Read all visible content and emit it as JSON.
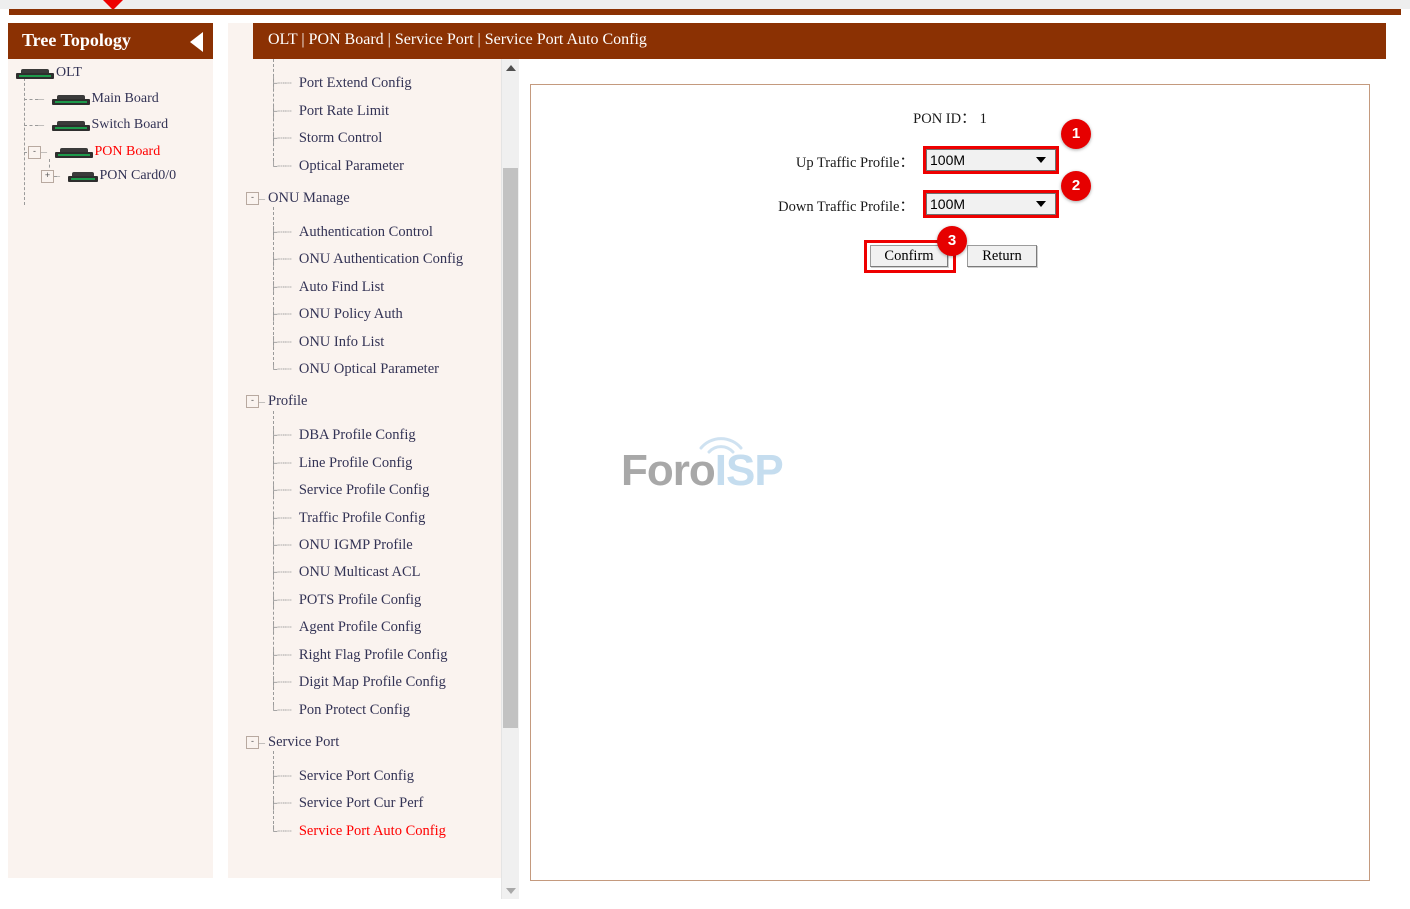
{
  "top": {
    "marker_icon": "red-down-arrow-marker"
  },
  "tree_panel": {
    "title": "Tree Topology",
    "collapse_icon": "collapse-left-arrow-icon",
    "nodes": [
      {
        "label": "OLT",
        "icon": "board-icon",
        "toggle": "",
        "level": 0,
        "red": false
      },
      {
        "label": "Main Board",
        "icon": "board-icon",
        "toggle": "",
        "level": 1,
        "red": false
      },
      {
        "label": "Switch Board",
        "icon": "board-icon",
        "toggle": "",
        "level": 1,
        "red": false
      },
      {
        "label": "PON Board",
        "icon": "board-icon",
        "toggle": "-",
        "level": 1,
        "red": true
      },
      {
        "label": "PON Card0/0",
        "icon": "board-icon",
        "toggle": "+",
        "level": 2,
        "red": false
      }
    ]
  },
  "menu": {
    "items": [
      {
        "label": "Port Extend Config",
        "type": "leaf",
        "red": false
      },
      {
        "label": "Port Rate Limit",
        "type": "leaf",
        "red": false
      },
      {
        "label": "Storm Control",
        "type": "leaf",
        "red": false
      },
      {
        "label": "Optical Parameter",
        "type": "leaf-last",
        "red": false
      },
      {
        "label": "ONU Manage",
        "type": "group",
        "red": false
      },
      {
        "label": "Authentication Control",
        "type": "leaf",
        "red": false
      },
      {
        "label": "ONU Authentication Config",
        "type": "leaf",
        "red": false
      },
      {
        "label": "Auto Find List",
        "type": "leaf",
        "red": false
      },
      {
        "label": "ONU Policy Auth",
        "type": "leaf",
        "red": false
      },
      {
        "label": "ONU Info List",
        "type": "leaf",
        "red": false
      },
      {
        "label": "ONU Optical Parameter",
        "type": "leaf-last",
        "red": false
      },
      {
        "label": "Profile",
        "type": "group",
        "red": false
      },
      {
        "label": "DBA Profile Config",
        "type": "leaf",
        "red": false
      },
      {
        "label": "Line Profile Config",
        "type": "leaf",
        "red": false
      },
      {
        "label": "Service Profile Config",
        "type": "leaf",
        "red": false
      },
      {
        "label": "Traffic Profile Config",
        "type": "leaf",
        "red": false
      },
      {
        "label": "ONU IGMP Profile",
        "type": "leaf",
        "red": false
      },
      {
        "label": "ONU Multicast ACL",
        "type": "leaf",
        "red": false
      },
      {
        "label": "POTS Profile Config",
        "type": "leaf",
        "red": false
      },
      {
        "label": "Agent Profile Config",
        "type": "leaf",
        "red": false
      },
      {
        "label": "Right Flag Profile Config",
        "type": "leaf",
        "red": false
      },
      {
        "label": "Digit Map Profile Config",
        "type": "leaf",
        "red": false
      },
      {
        "label": "Pon Protect Config",
        "type": "leaf-last",
        "red": false
      },
      {
        "label": "Service Port",
        "type": "group",
        "red": false
      },
      {
        "label": "Service Port Config",
        "type": "leaf",
        "red": false
      },
      {
        "label": "Service Port Cur Perf",
        "type": "leaf",
        "red": false
      },
      {
        "label": "Service Port Auto Config",
        "type": "leaf-last",
        "red": true
      }
    ],
    "scrollbar": {
      "up_icon": "scroll-up-arrow-icon",
      "down_icon": "scroll-down-arrow-icon"
    }
  },
  "content": {
    "breadcrumb": "OLT | PON Board | Service Port | Service Port Auto Config",
    "form": {
      "pon_id_label": "PON ID：",
      "pon_id_value": "1",
      "up_traffic_label": "Up Traffic Profile：",
      "up_traffic_value": "100M",
      "down_traffic_label": "Down Traffic Profile：",
      "down_traffic_value": "100M",
      "traffic_options": [
        "100M"
      ],
      "confirm_label": "Confirm",
      "return_label": "Return"
    },
    "annotations": [
      {
        "number": "1",
        "target": "up-traffic-profile-select"
      },
      {
        "number": "2",
        "target": "down-traffic-profile-select"
      },
      {
        "number": "3",
        "target": "confirm-button"
      }
    ],
    "watermark": {
      "part1": "Foro",
      "part2": "ISP"
    }
  },
  "colors": {
    "brand_brown": "#8b3103",
    "accent_red": "#ee0000",
    "panel_bg": "#faf3ef",
    "panel_border": "#c49a7e"
  }
}
